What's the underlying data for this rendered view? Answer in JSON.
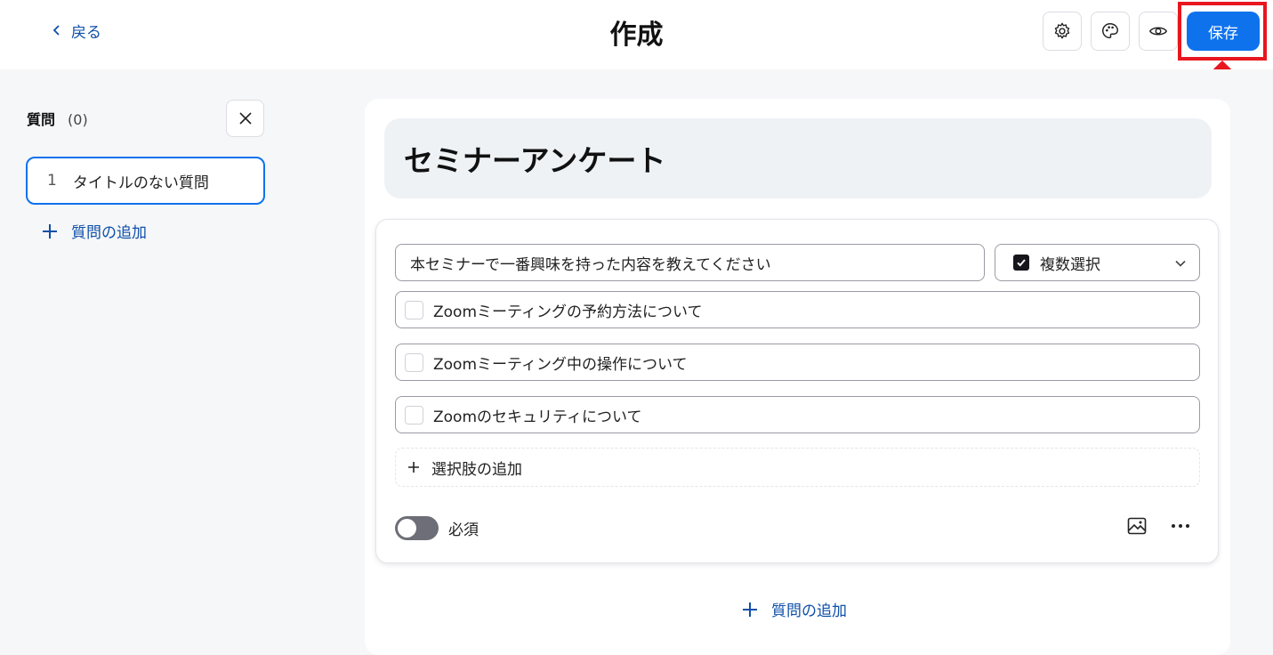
{
  "header": {
    "back_label": "戻る",
    "title": "作成",
    "save_label": "保存",
    "icons": [
      "gear-icon",
      "palette-icon",
      "eye-icon"
    ]
  },
  "sidebar": {
    "title": "質問",
    "count": "(0)",
    "items": [
      {
        "number": "1",
        "label": "タイトルのない質問"
      }
    ],
    "add_question_label": "質問の追加"
  },
  "survey": {
    "title": "セミナーアンケート",
    "question": {
      "text": "本セミナーで一番興味を持った内容を教えてください",
      "type_label": "複数選択",
      "options": [
        "Zoomミーティングの予約方法について",
        "Zoomミーティング中の操作について",
        "Zoomのセキュリティについて"
      ],
      "add_option_label": "選択肢の追加",
      "required_label": "必須",
      "required": false
    },
    "add_question_label": "質問の追加"
  },
  "colors": {
    "accent": "#0e72ed",
    "link": "#0e4fa8",
    "annotation": "#e8161f"
  }
}
